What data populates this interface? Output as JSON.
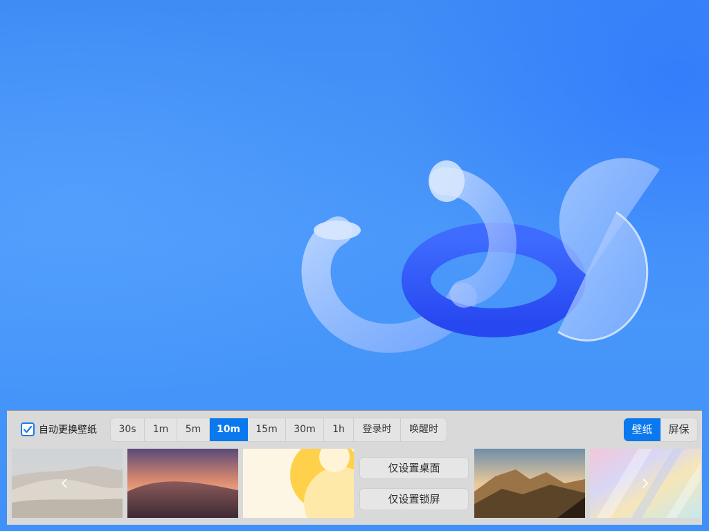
{
  "auto_change": {
    "label": "自动更换壁纸",
    "checked": true,
    "icon": "checkbox-checked-icon"
  },
  "intervals": [
    {
      "label": "30s",
      "selected": false
    },
    {
      "label": "1m",
      "selected": false
    },
    {
      "label": "5m",
      "selected": false
    },
    {
      "label": "10m",
      "selected": true
    },
    {
      "label": "15m",
      "selected": false
    },
    {
      "label": "30m",
      "selected": false
    },
    {
      "label": "1h",
      "selected": false
    },
    {
      "label": "登录时",
      "selected": false
    },
    {
      "label": "唤醒时",
      "selected": false
    }
  ],
  "mode_switch": {
    "wallpaper_label": "壁纸",
    "screensaver_label": "屏保",
    "active": "壁纸"
  },
  "actions": {
    "set_desktop_label": "仅设置桌面",
    "set_lockscreen_label": "仅设置锁屏"
  },
  "icons": {
    "prev": "chevron-left-icon",
    "next": "chevron-right-icon"
  },
  "colors": {
    "accent": "#0a78ee",
    "panel_bg": "#d9d9d9",
    "desktop_blue": "#4a98fa"
  }
}
